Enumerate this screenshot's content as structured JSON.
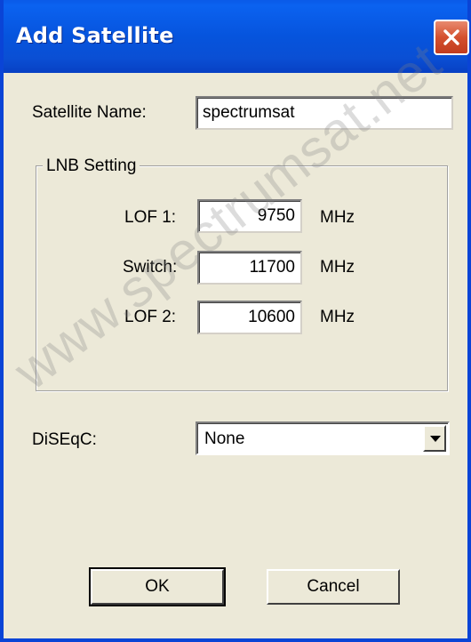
{
  "window": {
    "title": "Add Satellite",
    "title_color": "#ffffff",
    "titlebar_color": "#0a5ae8",
    "close_icon": "close-icon"
  },
  "form": {
    "satellite_name_label": "Satellite Name:",
    "satellite_name_value": "spectrumsat",
    "lnb_group_label": "LNB Setting",
    "lof1_label": "LOF 1:",
    "lof1_value": "9750",
    "lof1_unit": "MHz",
    "switch_label": "Switch:",
    "switch_value": "11700",
    "switch_unit": "MHz",
    "lof2_label": "LOF 2:",
    "lof2_value": "10600",
    "lof2_unit": "MHz",
    "diseqc_label": "DiSEqC:",
    "diseqc_value": "None",
    "diseqc_arrow_icon": "dropdown-arrow-icon"
  },
  "buttons": {
    "ok_label": "OK",
    "cancel_label": "Cancel"
  },
  "watermark": {
    "text": "www.spectrumsat.net"
  }
}
